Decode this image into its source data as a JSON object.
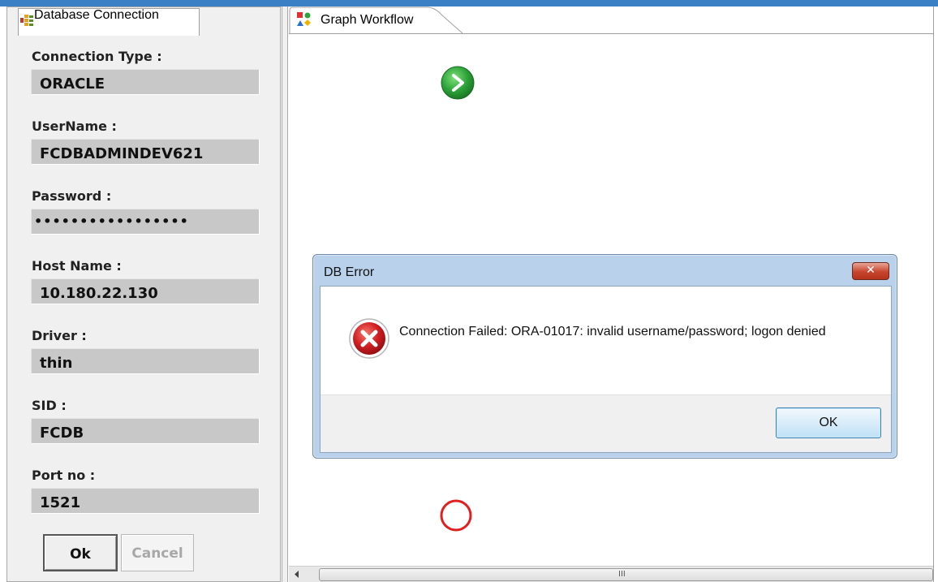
{
  "left_panel": {
    "tab_label": "Database Connection",
    "fields": [
      {
        "label": "Connection Type :",
        "value": "ORACLE"
      },
      {
        "label": "UserName :",
        "value": "FCDBADMINDEV621"
      },
      {
        "label": "Password :",
        "value": "•••••••••••••••••"
      },
      {
        "label": "Host Name :",
        "value": "10.180.22.130"
      },
      {
        "label": "Driver :",
        "value": "thin"
      },
      {
        "label": "SID :",
        "value": "FCDB"
      },
      {
        "label": "Port no :",
        "value": "1521"
      }
    ],
    "ok_label": "Ok",
    "cancel_label": "Cancel"
  },
  "graph": {
    "tab_label": "Graph Workflow",
    "start_node_icon": "play-icon",
    "end_node_icon": "stop-circle-icon",
    "scroll_grip": "III"
  },
  "dialog": {
    "title": "DB Error",
    "message": "Connection Failed: ORA-01017: invalid username/password; logon denied",
    "ok_label": "OK",
    "icon": "error-icon",
    "close_icon": "close-icon"
  },
  "colors": {
    "accent": "#3b7fc4",
    "start_node": "#2ea43a",
    "end_node": "#e02020",
    "error": "#c8141c"
  }
}
